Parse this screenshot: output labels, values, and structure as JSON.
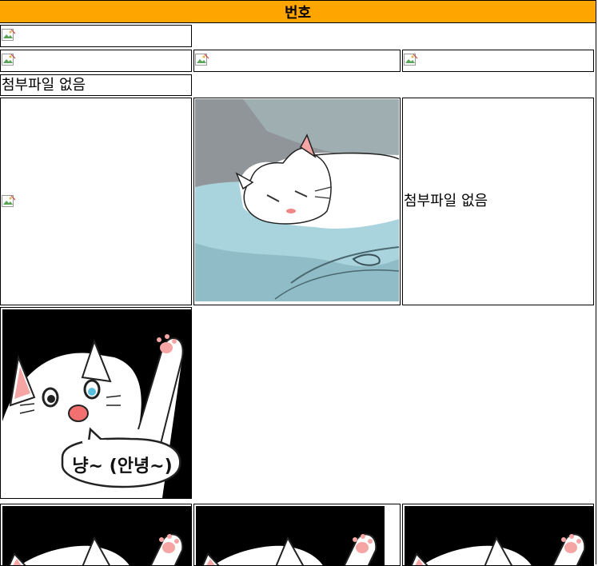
{
  "header": {
    "title": "번호"
  },
  "no_attachment_text": "첨부파일 없음",
  "speech_bubble_text": "냥~ (안녕~)",
  "images": {
    "broken_icon": "broken-image-icon",
    "sleeping_cat": "sleeping-white-cat-image",
    "waving_cat": "waving-white-cat-image"
  },
  "colors": {
    "header_bg": "#FFA500"
  }
}
